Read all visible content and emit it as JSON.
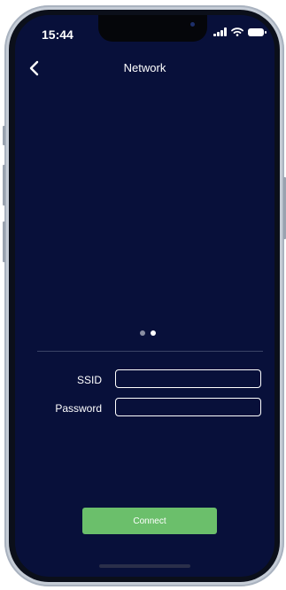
{
  "status_bar": {
    "time": "15:44"
  },
  "header": {
    "title": "Network",
    "back_icon": "chevron-left-icon"
  },
  "pager": {
    "total": 2,
    "active_index": 1
  },
  "form": {
    "ssid_label": "SSID",
    "ssid_value": "",
    "password_label": "Password",
    "password_value": ""
  },
  "actions": {
    "connect_label": "Connect"
  },
  "colors": {
    "background": "#08103a",
    "accent_button": "#6bbf6b",
    "text": "#ffffff"
  }
}
